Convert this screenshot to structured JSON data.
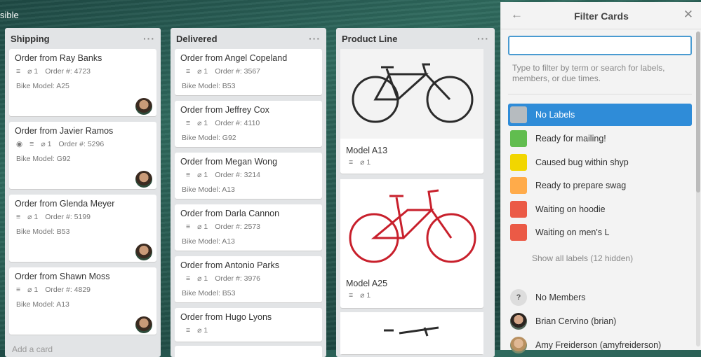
{
  "board": {
    "topbar_fragment": "sible"
  },
  "lists": [
    {
      "title": "Shipping",
      "menu": "···",
      "add_card": "Add a card",
      "cards": [
        {
          "title": "Order from Ray Banks",
          "attachments": "1",
          "order": "Order #: 4723",
          "model": "Bike Model: A25"
        },
        {
          "title": "Order from Javier Ramos",
          "attachments": "1",
          "order": "Order #: 5296",
          "model": "Bike Model: G92"
        },
        {
          "title": "Order from Glenda Meyer",
          "attachments": "1",
          "order": "Order #: 5199",
          "model": "Bike Model: B53"
        },
        {
          "title": "Order from Shawn Moss",
          "attachments": "1",
          "order": "Order #: 4829",
          "model": "Bike Model: A13"
        }
      ]
    },
    {
      "title": "Delivered",
      "menu": "···",
      "cards": [
        {
          "title": "Order from Angel Copeland",
          "attachments": "1",
          "order": "Order #: 3567",
          "model": "Bike Model: B53"
        },
        {
          "title": "Order from Jeffrey Cox",
          "attachments": "1",
          "order": "Order #: 4110",
          "model": "Bike Model: G92"
        },
        {
          "title": "Order from Megan Wong",
          "attachments": "1",
          "order": "Order #: 3214",
          "model": "Bike Model: A13"
        },
        {
          "title": "Order from Darla Cannon",
          "attachments": "1",
          "order": "Order #: 2573",
          "model": "Bike Model: A13"
        },
        {
          "title": "Order from Antonio Parks",
          "attachments": "1",
          "order": "Order #: 3976",
          "model": "Bike Model: B53"
        },
        {
          "title": "Order from Hugo Lyons",
          "attachments": "1"
        }
      ]
    },
    {
      "title": "Product Line",
      "menu": "···",
      "cards": [
        {
          "title": "Model A13",
          "attachments": "1",
          "color": "#2b2b2b"
        },
        {
          "title": "Model A25",
          "attachments": "1",
          "color": "#c8202c"
        }
      ]
    }
  ],
  "panel": {
    "title": "Filter Cards",
    "input_value": "",
    "hint": "Type to filter by term or search for labels, members, or due times.",
    "labels": [
      {
        "name": "No Labels",
        "color": "#b6bbbf",
        "active": true
      },
      {
        "name": "Ready for mailing!",
        "color": "#61bd4f"
      },
      {
        "name": "Caused bug within shyp",
        "color": "#f2d600"
      },
      {
        "name": "Ready to prepare swag",
        "color": "#ffab4a"
      },
      {
        "name": "Waiting on hoodie",
        "color": "#eb5a46"
      },
      {
        "name": "Waiting on men's L",
        "color": "#eb5a46"
      }
    ],
    "show_all": "Show all labels (12 hidden)",
    "members": [
      {
        "name": "No Members",
        "icon": "?"
      },
      {
        "name": "Brian Cervino (brian)"
      },
      {
        "name": "Amy Freiderson (amyfreiderson)"
      }
    ]
  }
}
